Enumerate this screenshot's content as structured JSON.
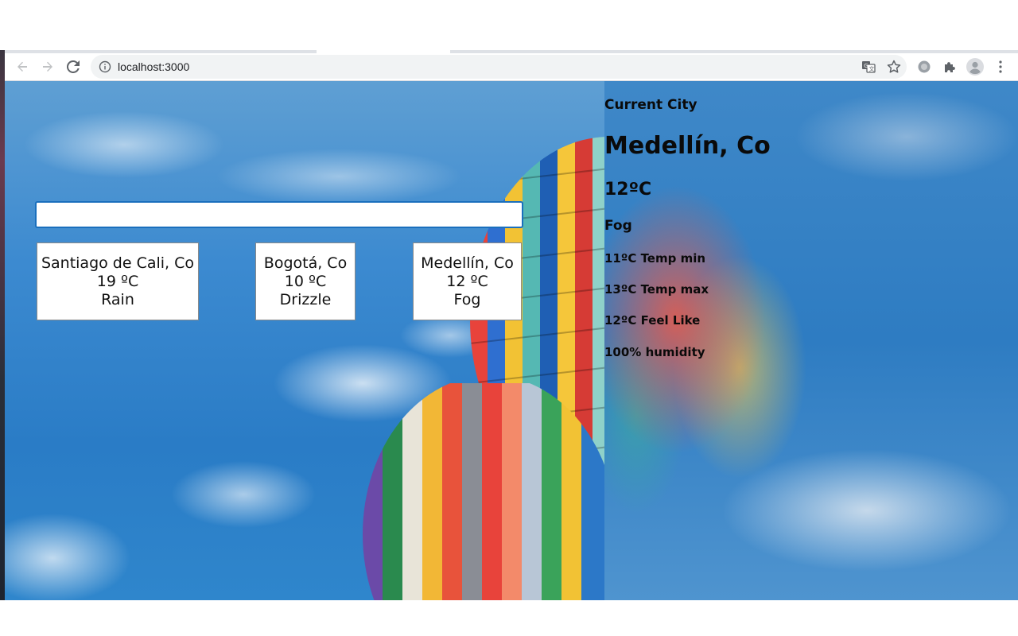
{
  "browser": {
    "url": "localhost:3000",
    "icons": [
      "back-arrow-icon",
      "forward-arrow-icon",
      "reload-icon",
      "info-icon",
      "translate-icon",
      "star-icon",
      "extension-icon",
      "puzzle-icon",
      "profile-avatar-icon",
      "menu-dots-icon"
    ]
  },
  "search": {
    "value": "",
    "placeholder": ""
  },
  "cities": [
    {
      "name": "Santiago de Cali, Co",
      "temp": "19 ºC",
      "condition": "Rain"
    },
    {
      "name": "Bogotá, Co",
      "temp": "10 ºC",
      "condition": "Drizzle"
    },
    {
      "name": "Medellín, Co",
      "temp": "12 ºC",
      "condition": "Fog"
    }
  ],
  "current": {
    "label": "Current City",
    "name": "Medellín, Co",
    "temp": "12ºC",
    "condition": "Fog",
    "temp_min": "11ºC Temp min",
    "temp_max": "13ºC Temp max",
    "feels_like": "12ºC Feel Like",
    "humidity": "100% humidity"
  },
  "colors": {
    "focus_border": "#1a6fbd",
    "card_border": "#8a8a8a",
    "sky": "#2f7fc0"
  }
}
